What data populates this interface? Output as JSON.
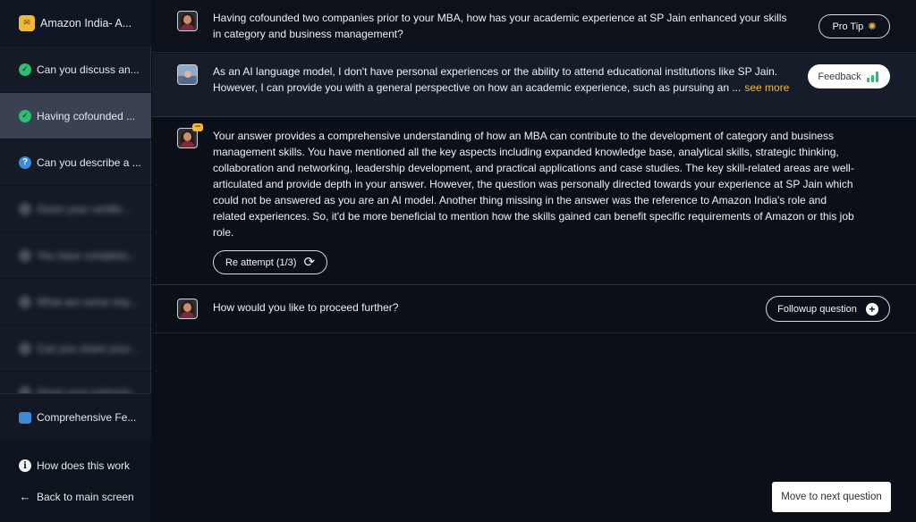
{
  "sidebar": {
    "header": {
      "icon": "app-icon",
      "label": "Amazon India- A..."
    },
    "items": [
      {
        "icon": "check-icon",
        "label": "Can you discuss an..."
      },
      {
        "icon": "check-icon",
        "label": "Having cofounded ..."
      },
      {
        "icon": "question-icon",
        "label": "Can you describe a ..."
      },
      {
        "icon": "question-icon",
        "label": "Given your certific..."
      },
      {
        "icon": "question-icon",
        "label": "You have completo..."
      },
      {
        "icon": "question-icon",
        "label": "What are some imp..."
      },
      {
        "icon": "question-icon",
        "label": "Can you share your..."
      },
      {
        "icon": "question-icon",
        "label": "Given your extensiv..."
      }
    ],
    "report": {
      "icon": "report-icon",
      "label": "Comprehensive Fe..."
    },
    "how_label": "How does this work",
    "back_label": "Back to main screen"
  },
  "conversation": {
    "question": {
      "line1": "Having cofounded two companies prior to your MBA, how has your academic experience at SP Jain enhanced your skills",
      "line2": "in category and business management?",
      "pro_tip_label": "Pro Tip"
    },
    "answer": {
      "line1": "As an AI language model, I don't have personal experiences or the ability to attend educational institutions like SP Jain.",
      "line2": "However, I can provide you with a general perspective on how an academic experience, such as pursuing an ...",
      "see_more": "see more",
      "feedback_label": "Feedback"
    },
    "feedback": {
      "lines": [
        "Your answer provides a comprehensive understanding of how an MBA can contribute to the development of category and business",
        "management skills. You have mentioned all the key aspects including expanded knowledge base, analytical skills, strategic thinking,",
        "collaboration and networking, leadership development, and practical applications and case studies. The key skill-related areas are well-",
        "articulated and provide depth in your answer. However, the question was personally directed towards your experience at SP Jain which",
        "could not be answered as you are an AI model. Another thing missing in the answer was the reference to Amazon India's role and",
        "related experiences. So, it'd be more beneficial to mention how the skills gained can benefit specific requirements of Amazon or this job",
        "role."
      ],
      "reattempt_label": "Re attempt (1/3)"
    },
    "proceed": {
      "text": "How would you like to proceed further?",
      "followup_label": "Followup question"
    }
  },
  "footer": {
    "next_label": "Move to next question"
  }
}
